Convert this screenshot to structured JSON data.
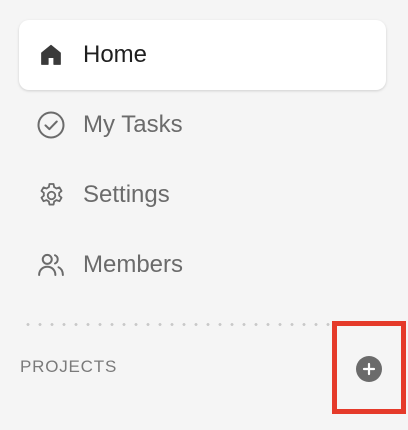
{
  "nav": {
    "items": [
      {
        "label": "Home",
        "icon": "home-icon",
        "active": true
      },
      {
        "label": "My Tasks",
        "icon": "check-circle-icon",
        "active": false
      },
      {
        "label": "Settings",
        "icon": "gear-icon",
        "active": false
      },
      {
        "label": "Members",
        "icon": "users-icon",
        "active": false
      }
    ]
  },
  "projects": {
    "header": "PROJECTS",
    "add_icon": "plus-circle-icon"
  },
  "colors": {
    "active_bg": "#ffffff",
    "sidebar_bg": "#f5f5f5",
    "active_text": "#1f1f1f",
    "muted_text": "#6b6b6b",
    "highlight": "#e53a2a"
  }
}
